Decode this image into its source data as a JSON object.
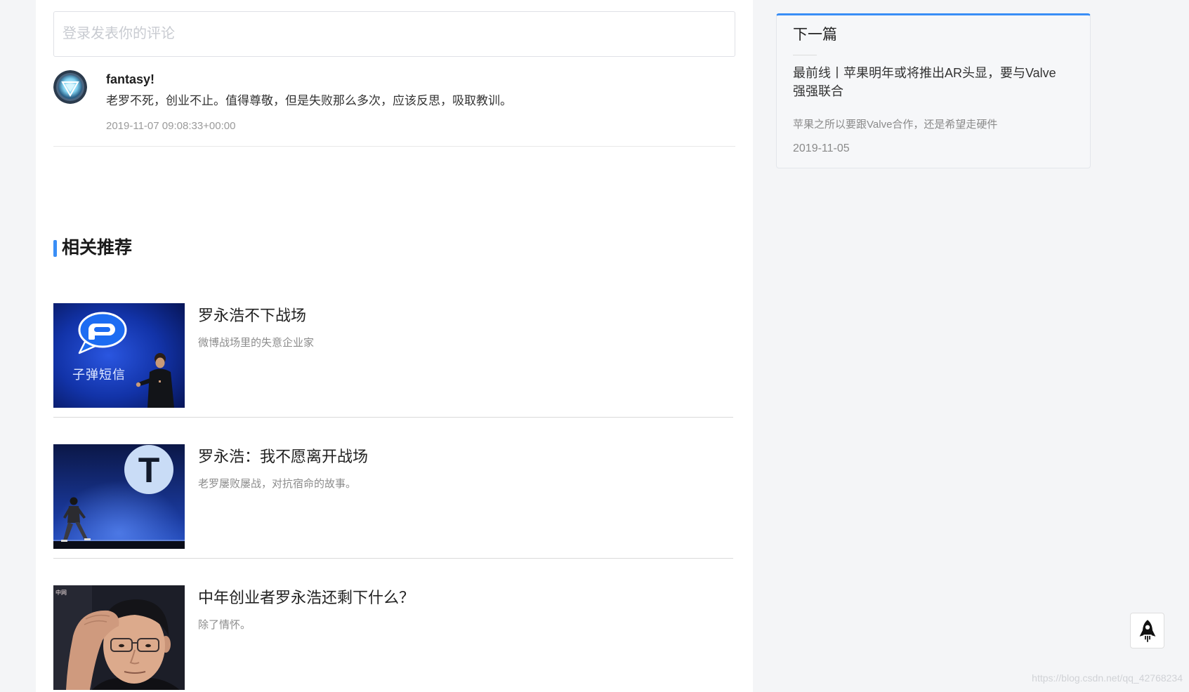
{
  "comments": {
    "input_placeholder": "登录发表你的评论",
    "items": [
      {
        "avatar_icon": "arc-reactor-avatar",
        "author": "fantasy!",
        "text": "老罗不死，创业不止。值得尊敬，但是失败那么多次，应该反思，吸取教训。",
        "time": "2019-11-07 09:08:33+00:00"
      }
    ]
  },
  "related": {
    "heading": "相关推荐",
    "items": [
      {
        "title": "罗永浩不下战场",
        "desc": "微博战场里的失意企业家",
        "thumb": {
          "icon": "bullet-messenger-logo",
          "caption": "子弹短信"
        }
      },
      {
        "title": "罗永浩：我不愿离开战场",
        "desc": "老罗屡败屡战，对抗宿命的故事。",
        "thumb": {
          "icon": "t-logo",
          "logo_letter": "T"
        }
      },
      {
        "title": "中年创业者罗永浩还剩下什么？",
        "desc": "除了情怀。",
        "thumb": {
          "icon": "portrait-photo",
          "watermark": "中网"
        }
      }
    ]
  },
  "next_article": {
    "label": "下一篇",
    "title": "最前线丨苹果明年或将推出AR头显，要与Valve强强联合",
    "summary": "苹果之所以要跟Valve合作，还是希望走硬件",
    "date": "2019-11-05"
  },
  "back_to_top": {
    "icon": "rocket-icon"
  },
  "watermark": "https://blog.csdn.net/qq_42768234",
  "colors": {
    "accent": "#3a8ef6",
    "page_background": "#f4f5f7",
    "panel_background": "#ffffff"
  }
}
